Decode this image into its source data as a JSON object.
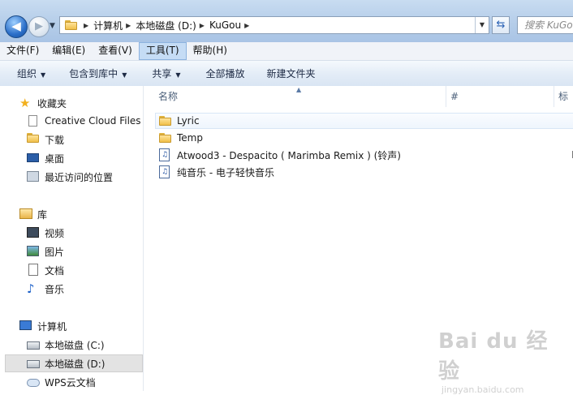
{
  "address_bar": {
    "crumbs": [
      "计算机",
      "本地磁盘 (D:)",
      "KuGou"
    ]
  },
  "search": {
    "placeholder": "搜索 KuGou"
  },
  "menu": [
    {
      "label": "文件(F)"
    },
    {
      "label": "编辑(E)"
    },
    {
      "label": "查看(V)"
    },
    {
      "label": "工具(T)",
      "active": true
    },
    {
      "label": "帮助(H)"
    }
  ],
  "toolbar": {
    "organize": "组织",
    "include_in_library": "包含到库中",
    "share": "共享",
    "play_all": "全部播放",
    "new_folder": "新建文件夹"
  },
  "sidebar": {
    "favorites": {
      "header": "收藏夹",
      "items": [
        "Creative Cloud Files",
        "下载",
        "桌面",
        "最近访问的位置"
      ]
    },
    "libraries": {
      "header": "库",
      "items": [
        "视频",
        "图片",
        "文档",
        "音乐"
      ]
    },
    "computer": {
      "header": "计算机",
      "items": [
        "本地磁盘 (C:)",
        "本地磁盘 (D:)",
        "WPS云文档"
      ],
      "selected": "本地磁盘 (D:)"
    }
  },
  "columns": {
    "name": "名称",
    "number": "#",
    "title": "标题"
  },
  "files": [
    {
      "name": "Lyric",
      "type": "folder"
    },
    {
      "name": "Temp",
      "type": "folder"
    },
    {
      "name": "Atwood3 - Despacito ( Marimba Remix ) (铃声)",
      "type": "music",
      "title": "De"
    },
    {
      "name": "纯音乐 - 电子轻快音乐",
      "type": "music"
    }
  ],
  "watermark": {
    "logo": "Bai du 经验",
    "url": "jingyan.baidu.com"
  }
}
